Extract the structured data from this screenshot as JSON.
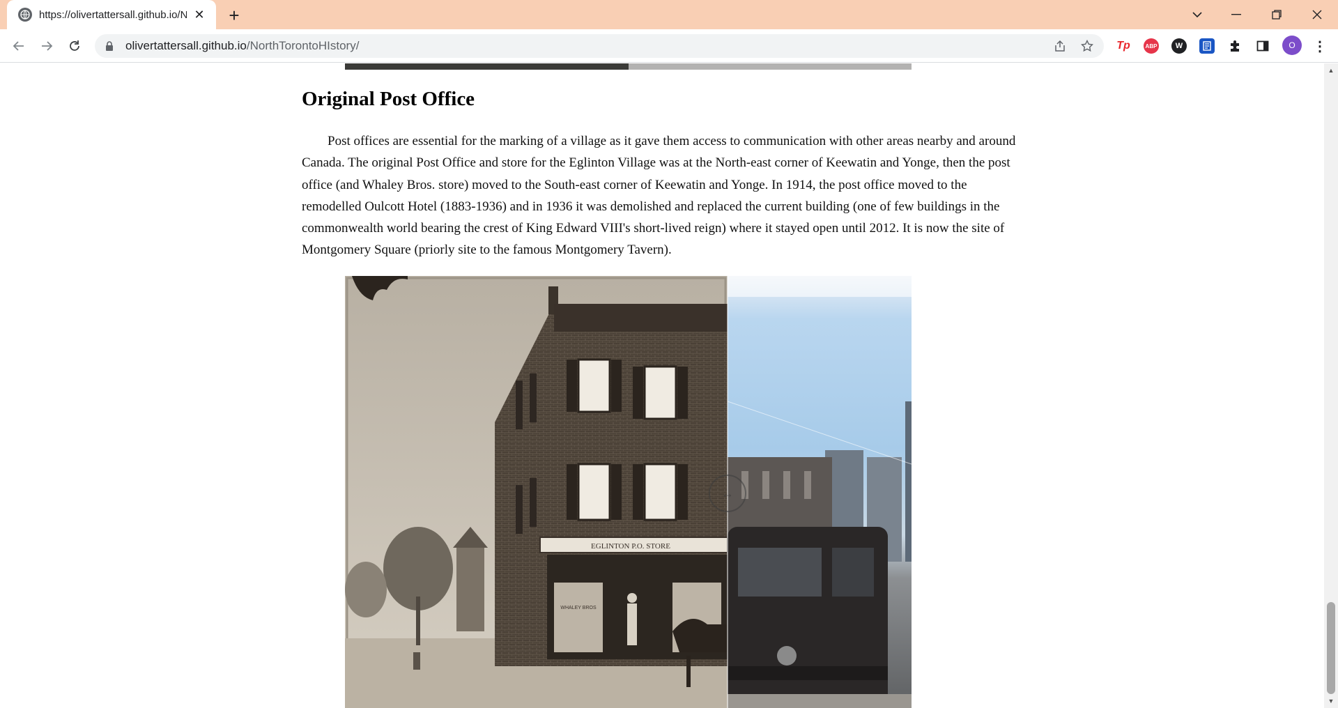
{
  "browser": {
    "tab_title": "https://olivertattersall.github.io/N",
    "url_host": "olivertattersall.github.io",
    "url_path": "/NorthTorontoHIstory/",
    "profile_initial": "O",
    "extensions": [
      "Tp",
      "ABP",
      "W",
      "bookmark-extension",
      "puzzle-icon",
      "side-panel-icon"
    ]
  },
  "page": {
    "section_title": "Original Post Office",
    "paragraph": "Post offices are essential for the marking of a village as it gave them access to communication with other areas nearby and around Canada. The original Post Office and store for the Eglinton Village was at the North-east corner of Keewatin and Yonge, then the post office (and Whaley Bros. store) moved to the South-east corner of Keewatin and Yonge. In 1914, the post office moved to the remodelled Oulcott Hotel (1883-1936) and in 1936 it was demolished and replaced the current building (one of few buildings in the commonwealth world bearing the crest of King Edward VIII's short-lived reign) where it stayed open until 2012. It is now the site of Montgomery Square (priorly site to the famous Montgomery Tavern).",
    "image_sign_store": "EGLINTON P.O. STORE",
    "image_sign_window": "WHALEY BROS"
  },
  "colors": {
    "tabstrip_bg": "#f9cfb4",
    "profile_bg": "#7c4dca",
    "abp_red": "#e6354a",
    "tp_red": "#e8262b"
  }
}
